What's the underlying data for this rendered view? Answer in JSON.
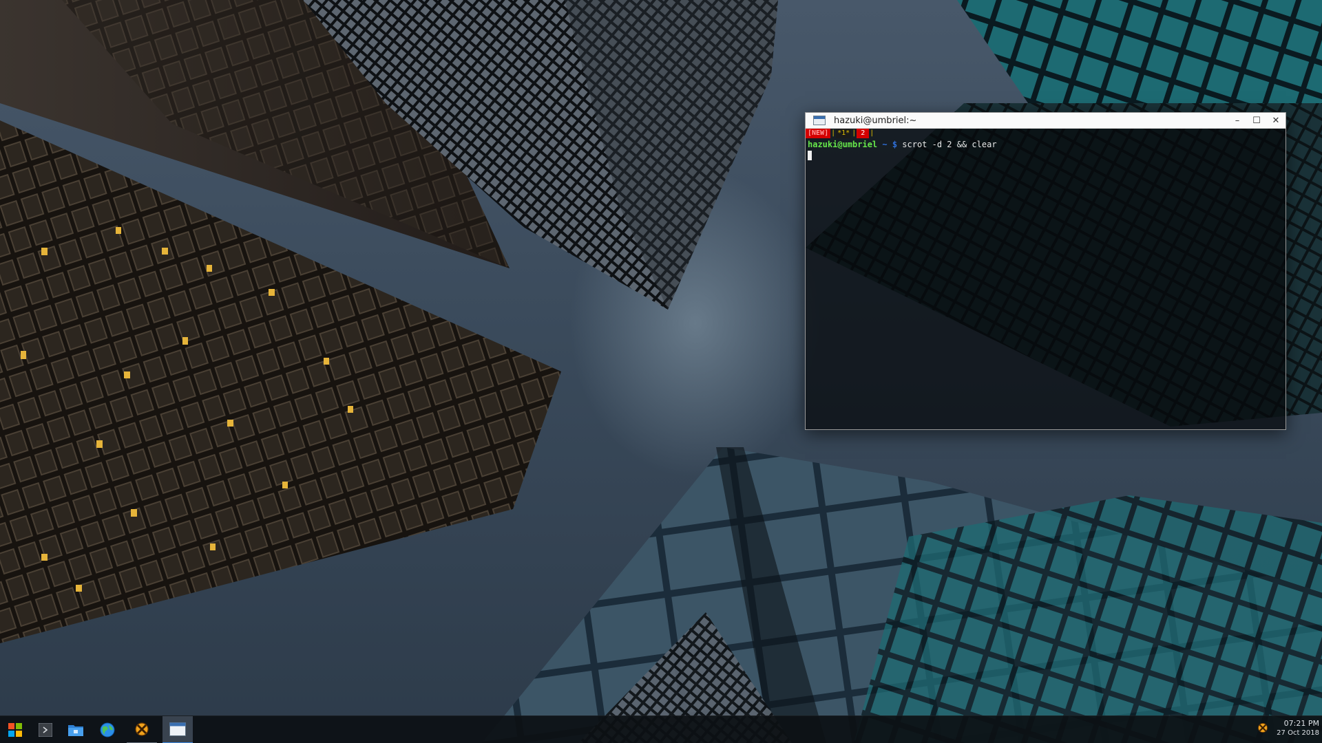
{
  "terminal": {
    "title": "hazuki@umbriel:~",
    "tmux": {
      "new_label": "[NEW]",
      "separator": "|",
      "active_window": "*1*",
      "second_window": "2"
    },
    "prompt": {
      "user_host": "hazuki@umbriel",
      "path": " ~ $ ",
      "command": "scrot -d 2 && clear"
    },
    "controls": {
      "minimize": "–",
      "maximize": "☐",
      "close": "✕"
    }
  },
  "taskbar": {
    "items": [
      {
        "name": "start-menu",
        "icon": "windows-logo-icon"
      },
      {
        "name": "terminal-launcher",
        "icon": "terminal-prompt-icon"
      },
      {
        "name": "file-manager",
        "icon": "folder-icon"
      },
      {
        "name": "web-browser",
        "icon": "globe-icon"
      },
      {
        "name": "system-tool",
        "icon": "x-circle-icon"
      },
      {
        "name": "terminal-window",
        "icon": "window-icon"
      }
    ],
    "clock": {
      "time": "07:21 PM",
      "date": "27 Oct 2018"
    }
  },
  "colors": {
    "prompt_user": "#66e64a",
    "prompt_path": "#2f6fd8",
    "tmux_red": "#d40000",
    "tmux_yellow": "#e0c000",
    "taskbar_accent": "#3d8be6"
  }
}
